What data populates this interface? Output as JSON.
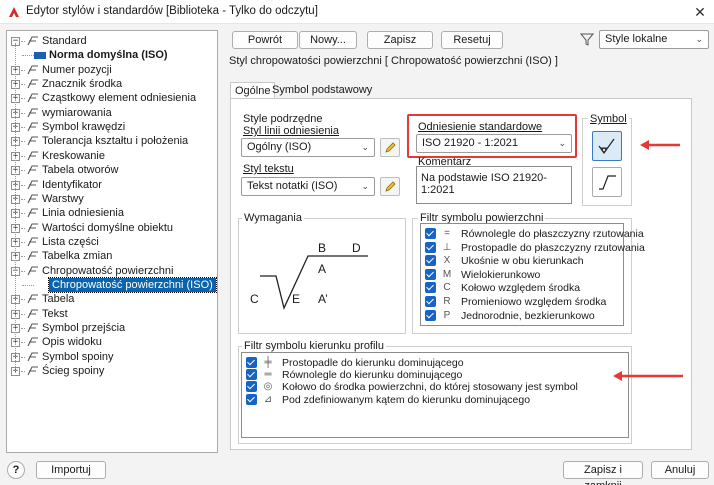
{
  "window": {
    "title": "Edytor stylów i standardów [Biblioteka - Tylko do odczytu]"
  },
  "tree": [
    {
      "label": "Standard",
      "level": 0,
      "expander": "-",
      "icon": "standard-icon"
    },
    {
      "label": "Norma domyślna (ISO)",
      "level": 1,
      "bold": true,
      "icon": "norm-icon"
    },
    {
      "label": "Numer pozycji",
      "level": 0,
      "expander": "+",
      "icon": "balloon-icon"
    },
    {
      "label": "Znacznik środka",
      "level": 0,
      "expander": "+",
      "icon": "center-mark-icon"
    },
    {
      "label": "Cząstkowy element odniesienia",
      "level": 0,
      "expander": "+",
      "icon": "datum-target-icon"
    },
    {
      "label": "wymiarowania",
      "level": 0,
      "expander": "+",
      "icon": "dimension-icon"
    },
    {
      "label": "Symbol krawędzi",
      "level": 0,
      "expander": "+",
      "icon": "edge-symbol-icon"
    },
    {
      "label": "Tolerancja kształtu i położenia",
      "level": 0,
      "expander": "+",
      "icon": "feature-control-icon"
    },
    {
      "label": "Kreskowanie",
      "level": 0,
      "expander": "+",
      "icon": "hatch-icon"
    },
    {
      "label": "Tabela otworów",
      "level": 0,
      "expander": "+",
      "icon": "hole-table-icon"
    },
    {
      "label": "Identyfikator",
      "level": 0,
      "expander": "+",
      "icon": "identifier-icon"
    },
    {
      "label": "Warstwy",
      "level": 0,
      "expander": "+",
      "icon": "layers-icon"
    },
    {
      "label": "Linia odniesienia",
      "level": 0,
      "expander": "+",
      "icon": "leader-icon"
    },
    {
      "label": "Wartości domyślne obiektu",
      "level": 0,
      "expander": "+",
      "icon": "object-defaults-icon"
    },
    {
      "label": "Lista części",
      "level": 0,
      "expander": "+",
      "icon": "parts-list-icon"
    },
    {
      "label": "Tabelka zmian",
      "level": 0,
      "expander": "+",
      "icon": "revision-table-icon"
    },
    {
      "label": "Chropowatość powierzchni",
      "level": 0,
      "expander": "-",
      "icon": "surface-texture-icon"
    },
    {
      "label": "Chropowatość powierzchni (ISO)",
      "level": 1,
      "selected": true,
      "icon": ""
    },
    {
      "label": "Tabela",
      "level": 0,
      "expander": "+",
      "icon": "table-icon"
    },
    {
      "label": "Tekst",
      "level": 0,
      "expander": "+",
      "icon": "text-icon"
    },
    {
      "label": "Symbol przejścia",
      "level": 0,
      "expander": "+",
      "icon": "taper-symbol-icon"
    },
    {
      "label": "Opis widoku",
      "level": 0,
      "expander": "+",
      "icon": "view-annotation-icon"
    },
    {
      "label": "Symbol spoiny",
      "level": 0,
      "expander": "+",
      "icon": "weld-symbol-icon"
    },
    {
      "label": "Ścieg spoiny",
      "level": 0,
      "expander": "+",
      "icon": "weld-bead-icon"
    }
  ],
  "toolbar": {
    "back": "Powrót",
    "new": "Nowy...",
    "save": "Zapisz",
    "reset": "Resetuj",
    "filter_value": "Style lokalne"
  },
  "heading": "Styl chropowatości powierzchni [ Chropowatość powierzchni (ISO) ]",
  "tabs": {
    "general": "Ogólne",
    "basic_symbol": "Symbol podstawowy"
  },
  "sub_styles": {
    "title": "Style podrzędne",
    "leader_label": "Styl linii odniesienia",
    "leader_value": "Ogólny (ISO)",
    "text_label": "Styl tekstu",
    "text_value": "Tekst notatki (ISO)"
  },
  "standard_reference": {
    "label": "Odniesienie standardowe",
    "value": "ISO 21920 - 1:2021",
    "comment_label": "Komentarz",
    "comment_value": "Na podstawie ISO 21920-1:2021"
  },
  "symbol": {
    "label": "Symbol"
  },
  "requirements": {
    "title": "Wymagania",
    "labels": [
      "B",
      "D",
      "A",
      "C",
      "E",
      "A’"
    ]
  },
  "surface_filter": {
    "title": "Filtr symbolu powierzchni",
    "items": [
      {
        "glyph": "=",
        "label": "Równolegle do płaszczyzny rzutowania"
      },
      {
        "glyph": "⊥",
        "label": "Prostopadle do płaszczyzny rzutowania"
      },
      {
        "glyph": "X",
        "label": "Ukośnie w obu kierunkach"
      },
      {
        "glyph": "M",
        "label": "Wielokierunkowo"
      },
      {
        "glyph": "C",
        "label": "Kołowo względem środka"
      },
      {
        "glyph": "R",
        "label": "Promieniowo względem środka"
      },
      {
        "glyph": "P",
        "label": "Jednorodnie, bezkierunkowo"
      }
    ]
  },
  "profile_filter": {
    "title": "Filtr symbolu kierunku profilu",
    "items": [
      {
        "glyph": "╪",
        "label": "Prostopadle do kierunku dominującego"
      },
      {
        "glyph": "═",
        "label": "Równolegle do kierunku dominującego"
      },
      {
        "glyph": "◎",
        "label": "Kołowo do środka powierzchni, do której stosowany jest symbol"
      },
      {
        "glyph": "⊿",
        "label": "Pod zdefiniowanym kątem do kierunku dominującego"
      }
    ]
  },
  "footer": {
    "help": "?",
    "import": "Importuj",
    "save_close": "Zapisz i zamknij",
    "cancel": "Anuluj"
  },
  "colors": {
    "highlight": "#e53935",
    "accent": "#1763c6",
    "selection": "#0a64ad"
  }
}
